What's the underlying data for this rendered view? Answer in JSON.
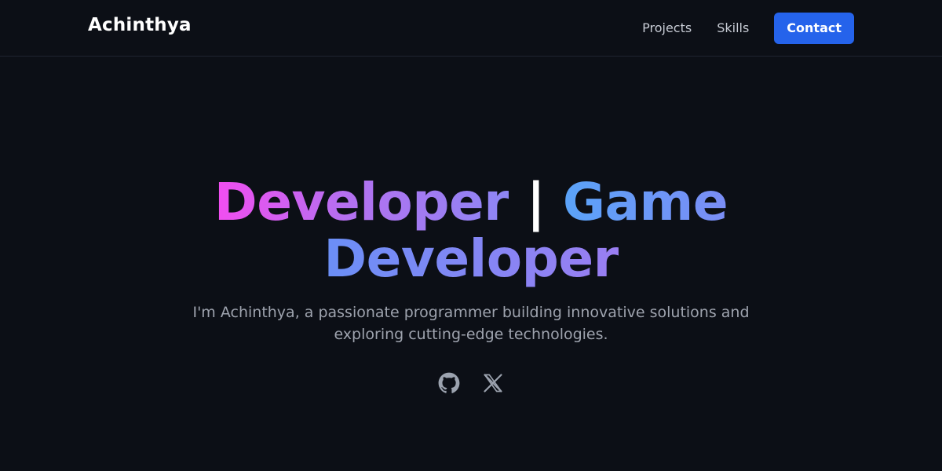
{
  "header": {
    "brand": "Achinthya",
    "nav": {
      "projects": "Projects",
      "skills": "Skills",
      "contact": "Contact"
    }
  },
  "hero": {
    "headline_part1": "Developer",
    "headline_separator": "|",
    "headline_part2": "Game",
    "headline_part3": "Developer",
    "tagline": "I'm Achinthya, a passionate programmer building innovative solutions and exploring cutting-edge technologies."
  },
  "socials": [
    {
      "icon": "github-icon"
    },
    {
      "icon": "x-icon"
    }
  ],
  "colors": {
    "background": "#0c0f16",
    "accent_button": "#2563eb",
    "gradient_pink": "#f24df0",
    "gradient_purple": "#9a7ef2",
    "gradient_blue": "#5aa3f8",
    "muted_text": "#9ea3ae",
    "icon": "#9ca3af"
  }
}
